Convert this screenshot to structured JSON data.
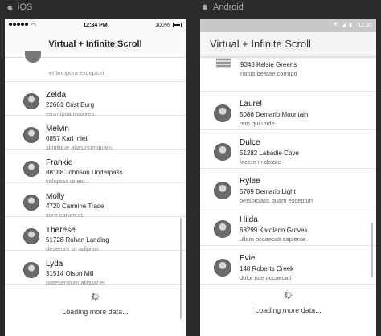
{
  "labels": {
    "ios": "iOS",
    "android": "Android"
  },
  "ios": {
    "status": {
      "time": "12:34 PM",
      "battery": "100%"
    },
    "title": "Virtual + Infinite Scroll",
    "partial_item": {
      "desc": "et tempora excepturi"
    },
    "items": [
      {
        "name": "Zelda",
        "addr": "22661 Crist Burg",
        "desc": "error ipsa maiores"
      },
      {
        "name": "Melvin",
        "addr": "0857 Karl Inlet",
        "desc": "similique alias numquam"
      },
      {
        "name": "Frankie",
        "addr": "88188 Johnson Underpass",
        "desc": "voluptas ut est"
      },
      {
        "name": "Molly",
        "addr": "4720 Carmine Trace",
        "desc": "sunt earum et"
      },
      {
        "name": "Therese",
        "addr": "51728 Rohan Landing",
        "desc": "deserunt sit adipisci"
      },
      {
        "name": "Lyda",
        "addr": "31514 Olson Mill",
        "desc": "praesentium aliquid et"
      }
    ],
    "loading": "Loading more data..."
  },
  "android": {
    "status": {
      "time": "12:30"
    },
    "title": "Virtual + Infinite Scroll",
    "partial_item": {
      "addr": "9348 Kelsie Greens",
      "desc": "natus beatae corrupti"
    },
    "items": [
      {
        "name": "Laurel",
        "addr": "5086 Demario Mountain",
        "desc": "rem qui unde"
      },
      {
        "name": "Dulce",
        "addr": "51282 Labadie Cove",
        "desc": "facere in dolore"
      },
      {
        "name": "Rylee",
        "addr": "5789 Demario Light",
        "desc": "perspiciatis quam excepturi"
      },
      {
        "name": "Hilda",
        "addr": "68299 Karolann Groves",
        "desc": "ullam occaecati sapiente"
      },
      {
        "name": "Evie",
        "addr": "148 Roberts Creek",
        "desc": "dolor iste occaecati"
      }
    ],
    "loading": "Loading more data..."
  },
  "icons": {
    "ios_label_icon": "apple-icon",
    "android_label_icon": "android-icon",
    "spinner": "spinner-icon"
  }
}
